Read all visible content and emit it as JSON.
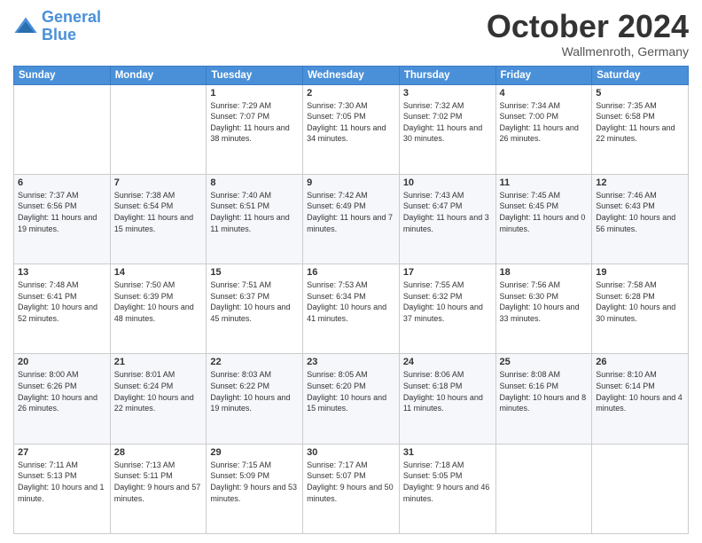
{
  "header": {
    "logo_line1": "General",
    "logo_line2": "Blue",
    "month": "October 2024",
    "location": "Wallmenroth, Germany"
  },
  "weekdays": [
    "Sunday",
    "Monday",
    "Tuesday",
    "Wednesday",
    "Thursday",
    "Friday",
    "Saturday"
  ],
  "weeks": [
    [
      {
        "day": "",
        "info": ""
      },
      {
        "day": "",
        "info": ""
      },
      {
        "day": "1",
        "info": "Sunrise: 7:29 AM\nSunset: 7:07 PM\nDaylight: 11 hours and 38 minutes."
      },
      {
        "day": "2",
        "info": "Sunrise: 7:30 AM\nSunset: 7:05 PM\nDaylight: 11 hours and 34 minutes."
      },
      {
        "day": "3",
        "info": "Sunrise: 7:32 AM\nSunset: 7:02 PM\nDaylight: 11 hours and 30 minutes."
      },
      {
        "day": "4",
        "info": "Sunrise: 7:34 AM\nSunset: 7:00 PM\nDaylight: 11 hours and 26 minutes."
      },
      {
        "day": "5",
        "info": "Sunrise: 7:35 AM\nSunset: 6:58 PM\nDaylight: 11 hours and 22 minutes."
      }
    ],
    [
      {
        "day": "6",
        "info": "Sunrise: 7:37 AM\nSunset: 6:56 PM\nDaylight: 11 hours and 19 minutes."
      },
      {
        "day": "7",
        "info": "Sunrise: 7:38 AM\nSunset: 6:54 PM\nDaylight: 11 hours and 15 minutes."
      },
      {
        "day": "8",
        "info": "Sunrise: 7:40 AM\nSunset: 6:51 PM\nDaylight: 11 hours and 11 minutes."
      },
      {
        "day": "9",
        "info": "Sunrise: 7:42 AM\nSunset: 6:49 PM\nDaylight: 11 hours and 7 minutes."
      },
      {
        "day": "10",
        "info": "Sunrise: 7:43 AM\nSunset: 6:47 PM\nDaylight: 11 hours and 3 minutes."
      },
      {
        "day": "11",
        "info": "Sunrise: 7:45 AM\nSunset: 6:45 PM\nDaylight: 11 hours and 0 minutes."
      },
      {
        "day": "12",
        "info": "Sunrise: 7:46 AM\nSunset: 6:43 PM\nDaylight: 10 hours and 56 minutes."
      }
    ],
    [
      {
        "day": "13",
        "info": "Sunrise: 7:48 AM\nSunset: 6:41 PM\nDaylight: 10 hours and 52 minutes."
      },
      {
        "day": "14",
        "info": "Sunrise: 7:50 AM\nSunset: 6:39 PM\nDaylight: 10 hours and 48 minutes."
      },
      {
        "day": "15",
        "info": "Sunrise: 7:51 AM\nSunset: 6:37 PM\nDaylight: 10 hours and 45 minutes."
      },
      {
        "day": "16",
        "info": "Sunrise: 7:53 AM\nSunset: 6:34 PM\nDaylight: 10 hours and 41 minutes."
      },
      {
        "day": "17",
        "info": "Sunrise: 7:55 AM\nSunset: 6:32 PM\nDaylight: 10 hours and 37 minutes."
      },
      {
        "day": "18",
        "info": "Sunrise: 7:56 AM\nSunset: 6:30 PM\nDaylight: 10 hours and 33 minutes."
      },
      {
        "day": "19",
        "info": "Sunrise: 7:58 AM\nSunset: 6:28 PM\nDaylight: 10 hours and 30 minutes."
      }
    ],
    [
      {
        "day": "20",
        "info": "Sunrise: 8:00 AM\nSunset: 6:26 PM\nDaylight: 10 hours and 26 minutes."
      },
      {
        "day": "21",
        "info": "Sunrise: 8:01 AM\nSunset: 6:24 PM\nDaylight: 10 hours and 22 minutes."
      },
      {
        "day": "22",
        "info": "Sunrise: 8:03 AM\nSunset: 6:22 PM\nDaylight: 10 hours and 19 minutes."
      },
      {
        "day": "23",
        "info": "Sunrise: 8:05 AM\nSunset: 6:20 PM\nDaylight: 10 hours and 15 minutes."
      },
      {
        "day": "24",
        "info": "Sunrise: 8:06 AM\nSunset: 6:18 PM\nDaylight: 10 hours and 11 minutes."
      },
      {
        "day": "25",
        "info": "Sunrise: 8:08 AM\nSunset: 6:16 PM\nDaylight: 10 hours and 8 minutes."
      },
      {
        "day": "26",
        "info": "Sunrise: 8:10 AM\nSunset: 6:14 PM\nDaylight: 10 hours and 4 minutes."
      }
    ],
    [
      {
        "day": "27",
        "info": "Sunrise: 7:11 AM\nSunset: 5:13 PM\nDaylight: 10 hours and 1 minute."
      },
      {
        "day": "28",
        "info": "Sunrise: 7:13 AM\nSunset: 5:11 PM\nDaylight: 9 hours and 57 minutes."
      },
      {
        "day": "29",
        "info": "Sunrise: 7:15 AM\nSunset: 5:09 PM\nDaylight: 9 hours and 53 minutes."
      },
      {
        "day": "30",
        "info": "Sunrise: 7:17 AM\nSunset: 5:07 PM\nDaylight: 9 hours and 50 minutes."
      },
      {
        "day": "31",
        "info": "Sunrise: 7:18 AM\nSunset: 5:05 PM\nDaylight: 9 hours and 46 minutes."
      },
      {
        "day": "",
        "info": ""
      },
      {
        "day": "",
        "info": ""
      }
    ]
  ]
}
